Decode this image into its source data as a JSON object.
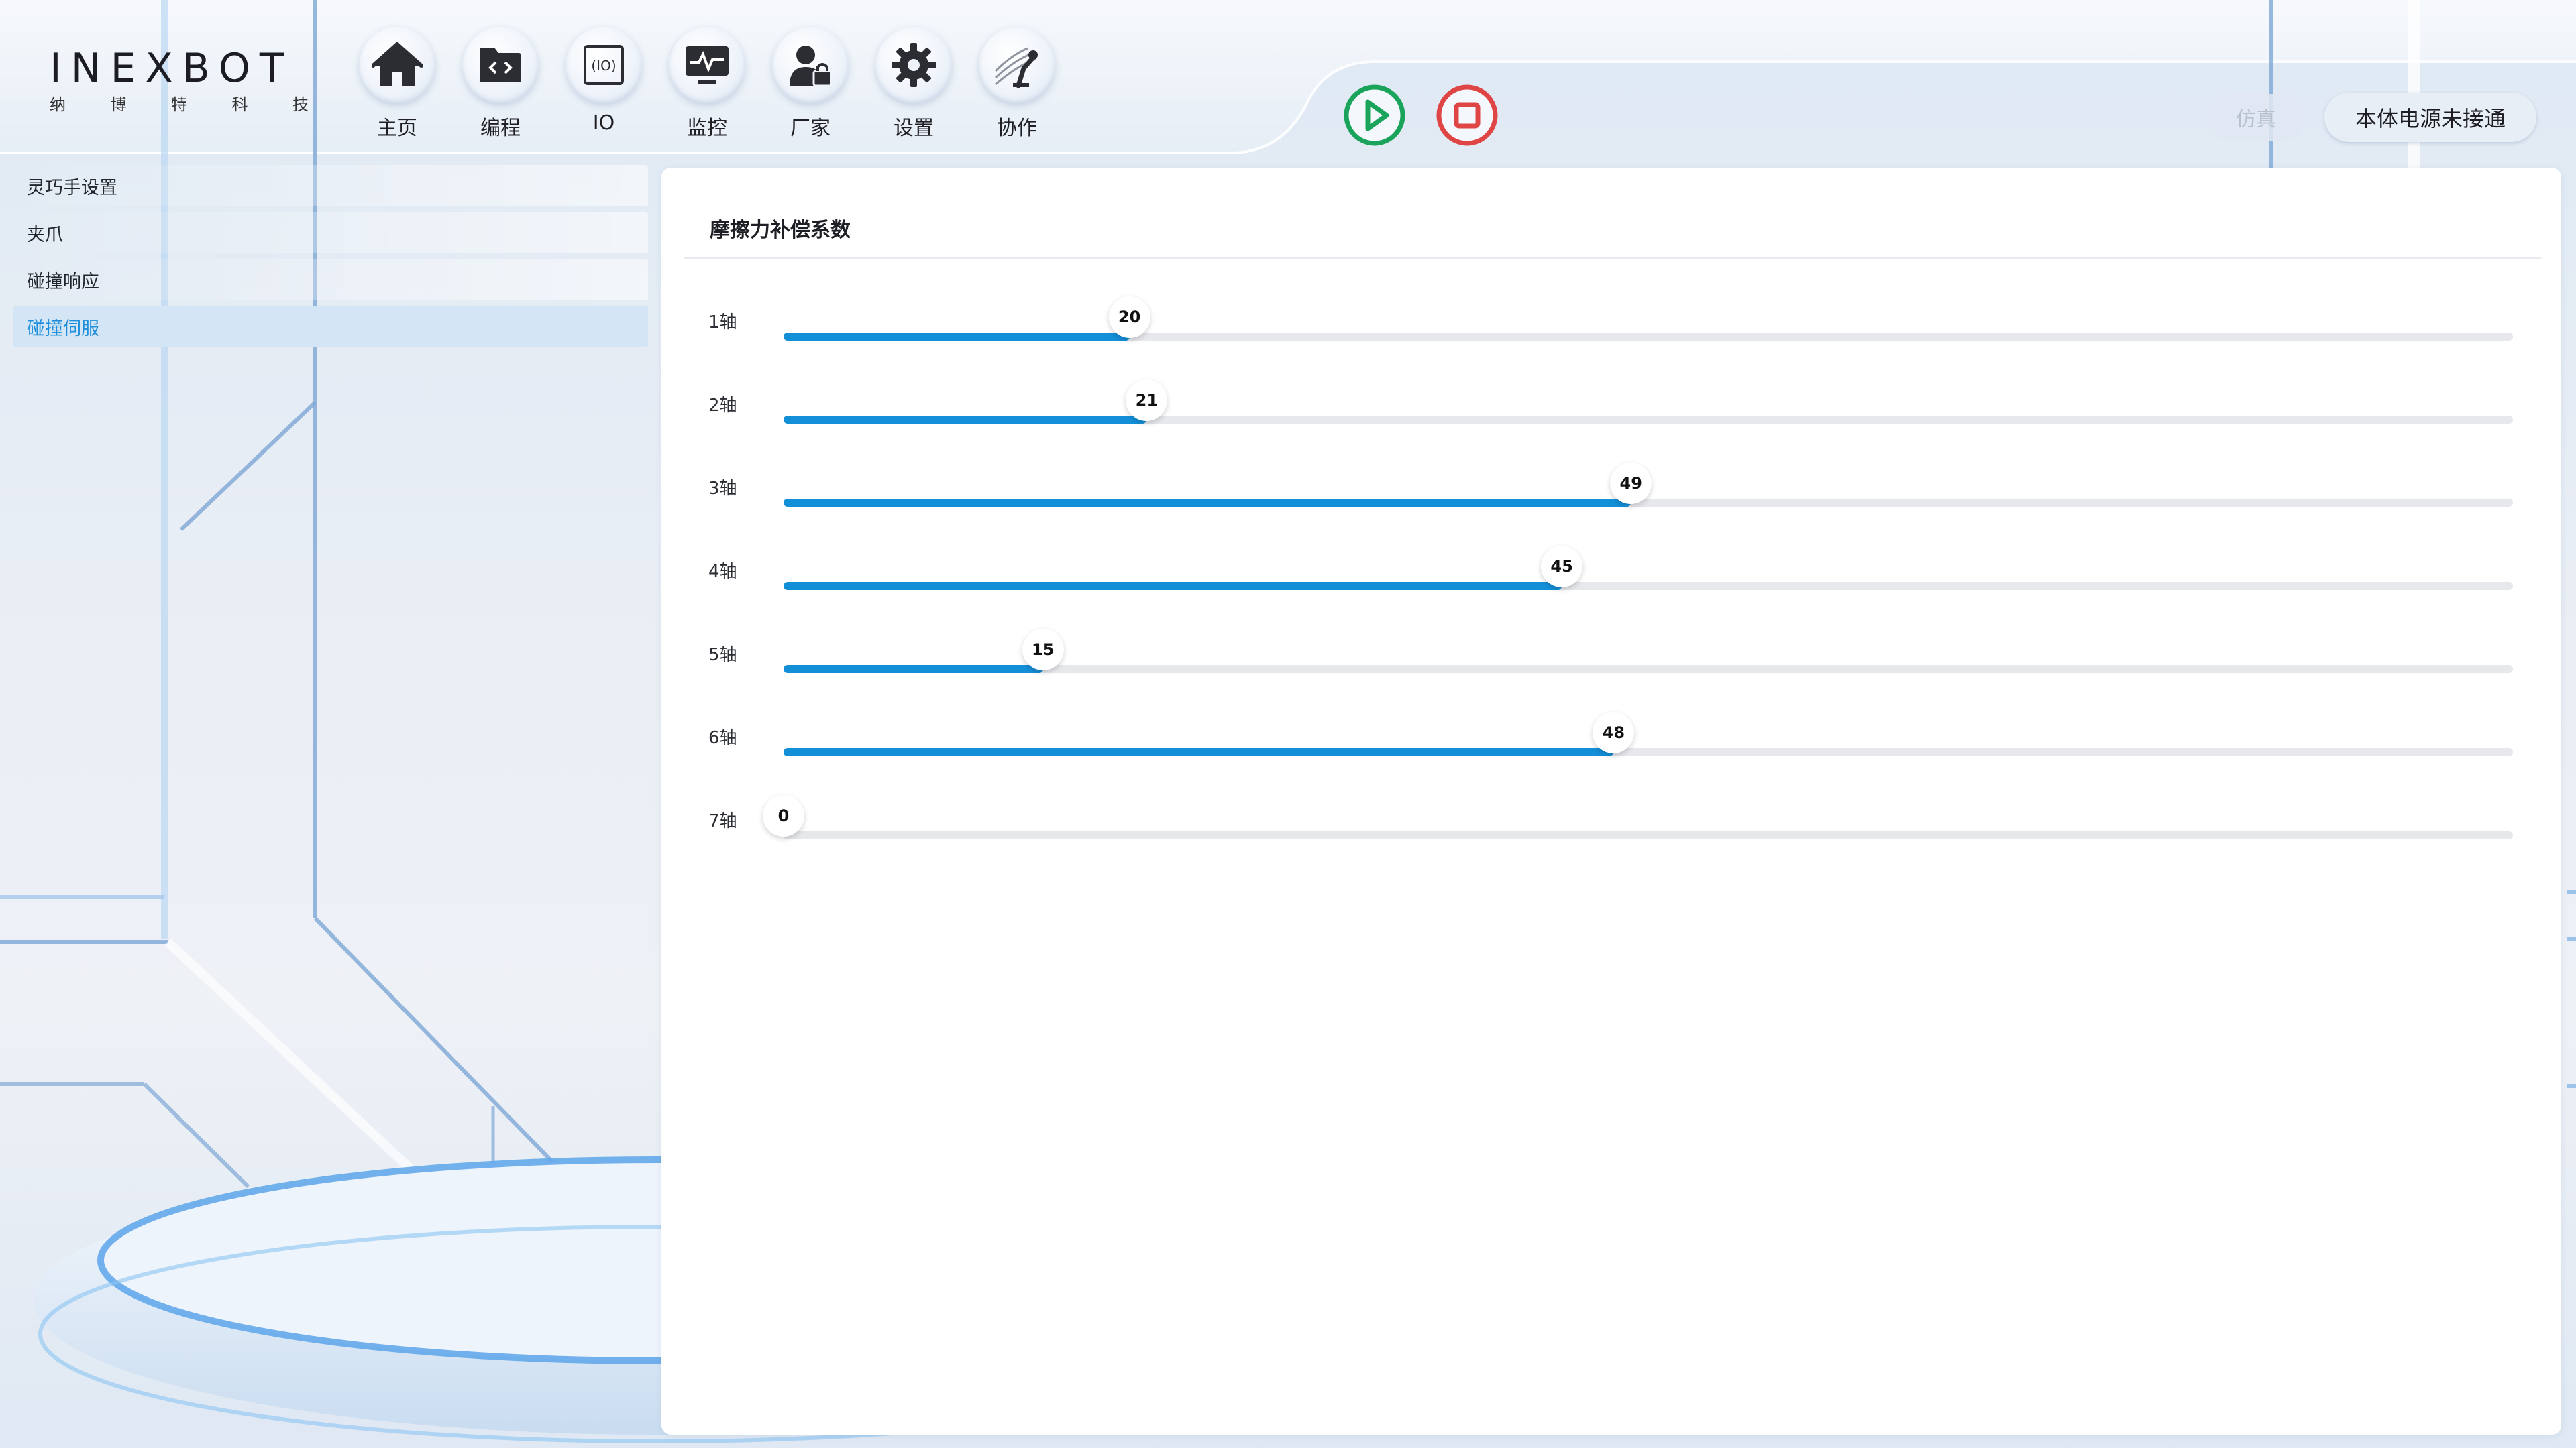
{
  "app": {
    "logo_text": "INEXBOT",
    "logo_sub": [
      "纳",
      "博",
      "特",
      "科",
      "技"
    ]
  },
  "nav": [
    {
      "label": "主页",
      "icon": "home-icon"
    },
    {
      "label": "编程",
      "icon": "program-folder-icon"
    },
    {
      "label": "IO",
      "icon": "io-icon"
    },
    {
      "label": "监控",
      "icon": "monitor-icon"
    },
    {
      "label": "厂家",
      "icon": "manufacturer-lock-icon"
    },
    {
      "label": "设置",
      "icon": "gear-icon"
    },
    {
      "label": "协作",
      "icon": "collaboration-robot-icon"
    }
  ],
  "controls": {
    "run_icon": "play-icon",
    "stop_icon": "stop-icon",
    "run_color": "#1aa35a",
    "stop_color": "#e04545"
  },
  "header": {
    "sim_label": "仿真",
    "power_label": "本体电源未接通"
  },
  "sidebar": {
    "items": [
      {
        "label": "灵巧手设置",
        "active": false
      },
      {
        "label": "夹爪",
        "active": false
      },
      {
        "label": "碰撞响应",
        "active": false
      },
      {
        "label": "碰撞伺服",
        "active": true
      }
    ]
  },
  "panel": {
    "title": "摩擦力补偿系数",
    "slider_max": 100,
    "accent": "#138fd8",
    "axes": [
      {
        "label": "1轴",
        "value": 20
      },
      {
        "label": "2轴",
        "value": 21
      },
      {
        "label": "3轴",
        "value": 49
      },
      {
        "label": "4轴",
        "value": 45
      },
      {
        "label": "5轴",
        "value": 15
      },
      {
        "label": "6轴",
        "value": 48
      },
      {
        "label": "7轴",
        "value": 0
      }
    ]
  }
}
